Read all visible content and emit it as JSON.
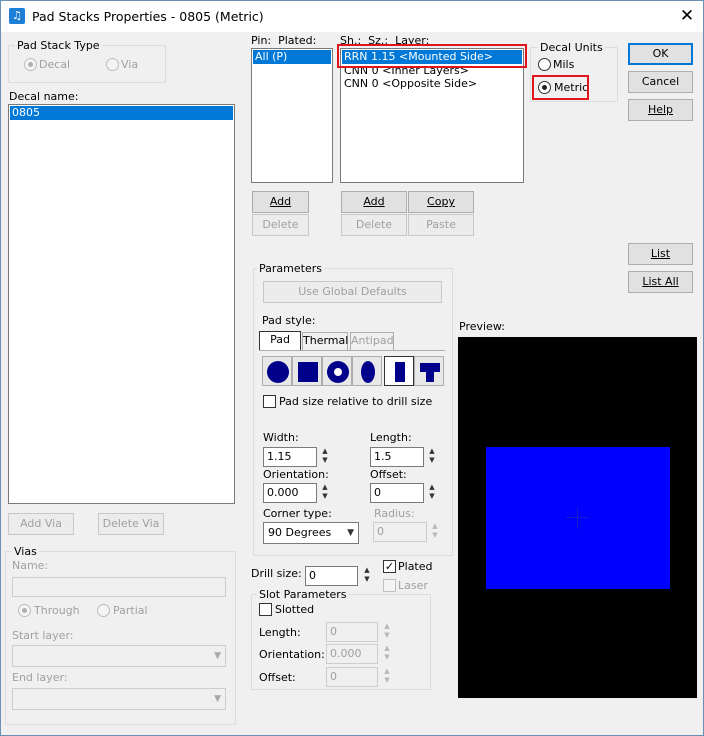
{
  "window": {
    "title": "Pad Stacks Properties - 0805 (Metric)",
    "close_glyph": "✕"
  },
  "pad_stack_type": {
    "label": "Pad Stack Type",
    "decal": "Decal",
    "via": "Via",
    "selected": "Decal"
  },
  "decal_name": {
    "label": "Decal name:",
    "items": [
      "0805"
    ],
    "add_via": "Add Via",
    "delete_via": "Delete Via"
  },
  "vias": {
    "label": "Vias",
    "name_label": "Name:",
    "through": "Through",
    "partial": "Partial",
    "start_layer": "Start layer:",
    "end_layer": "End layer:"
  },
  "pins": {
    "header": "Pin:  Plated:",
    "items": [
      "All (P)"
    ],
    "add": "Add",
    "delete": "Delete"
  },
  "layers": {
    "header": "Sh.:  Sz.:  Layer:",
    "items": [
      "RRN 1.15 <Mounted Side>",
      "CNN 0 <Inner Layers>",
      "CNN 0 <Opposite Side>"
    ],
    "add": "Add",
    "copy": "Copy",
    "delete": "Delete",
    "paste": "Paste"
  },
  "decal_units": {
    "label": "Decal Units",
    "mils": "Mils",
    "metric": "Metric",
    "selected": "Metric"
  },
  "actions": {
    "ok": "OK",
    "cancel": "Cancel",
    "help": "Help",
    "list": "List",
    "list_all": "List All"
  },
  "parameters": {
    "label": "Parameters",
    "use_global_defaults": "Use Global Defaults",
    "pad_style": "Pad style:",
    "tabs": [
      "Pad",
      "Thermal",
      "Antipad"
    ],
    "active_tab": "Pad",
    "shapes": [
      "round-pad",
      "square-pad",
      "annular-pad",
      "oval-pad",
      "rectangle-pad",
      "custom-pad"
    ],
    "selected_shape": "rectangle-pad",
    "pad_size_relative": "Pad size relative to drill size",
    "width_label": "Width:",
    "width": "1.15",
    "length_label": "Length:",
    "length": "1.5",
    "orientation_label": "Orientation:",
    "orientation": "0.000",
    "offset_label": "Offset:",
    "offset": "0",
    "corner_type_label": "Corner type:",
    "corner_type": "90 Degrees",
    "radius_label": "Radius:",
    "radius": "0"
  },
  "drill": {
    "label": "Drill size:",
    "value": "0",
    "plated": "Plated",
    "laser": "Laser"
  },
  "slot": {
    "label": "Slot Parameters",
    "slotted": "Slotted",
    "length_label": "Length:",
    "length": "0",
    "orientation_label": "Orientation:",
    "orientation": "0.000",
    "offset_label": "Offset:",
    "offset": "0"
  },
  "preview": {
    "label": "Preview:",
    "background": "#000000",
    "pad_color": "#0000ff"
  }
}
